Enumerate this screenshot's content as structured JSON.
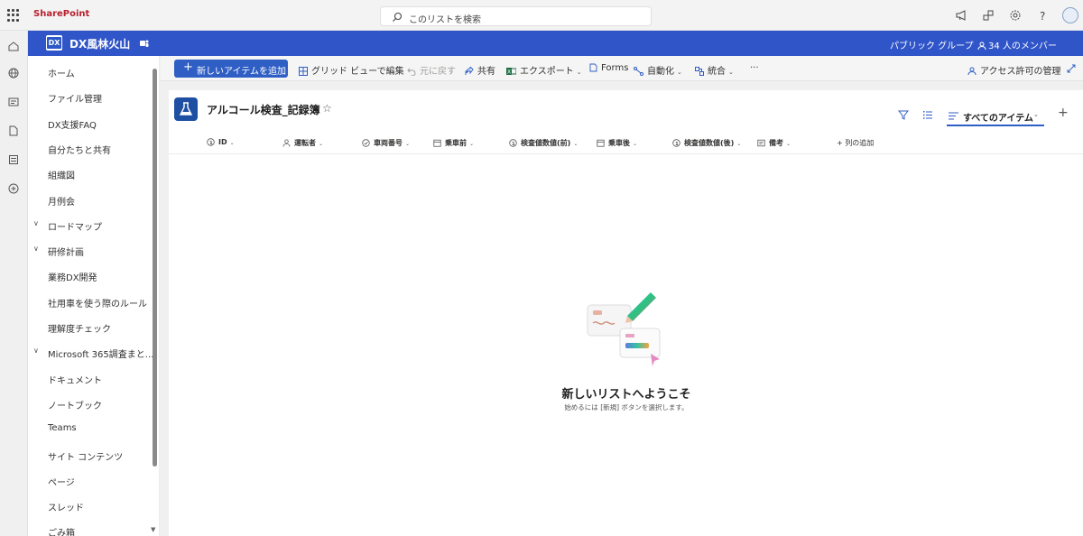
{
  "suite": {
    "brand": "SharePoint",
    "search_placeholder": "このリストを検索"
  },
  "site": {
    "logo_text": "DX",
    "name": "DX風林火山",
    "group_type": "パブリック グループ",
    "members": "34 人のメンバー"
  },
  "nav": {
    "items": [
      {
        "label": "ホーム"
      },
      {
        "label": "ファイル管理"
      },
      {
        "label": "DX支援FAQ"
      },
      {
        "label": "自分たちと共有"
      },
      {
        "label": "組織図"
      },
      {
        "label": "月例会"
      },
      {
        "label": "ロードマップ",
        "expandable": true
      },
      {
        "label": "研修計画",
        "expandable": true
      },
      {
        "label": "業務DX開発"
      },
      {
        "label": "社用車を使う際のルール"
      },
      {
        "label": "理解度チェック"
      },
      {
        "label": "Microsoft 365調査まと...",
        "expandable": true
      },
      {
        "label": "ドキュメント"
      },
      {
        "label": "ノートブック"
      },
      {
        "label": "Teams"
      },
      {
        "label": "サイト コンテンツ"
      },
      {
        "label": "ページ"
      },
      {
        "label": "スレッド"
      },
      {
        "label": "ごみ箱"
      }
    ]
  },
  "commands": {
    "new_item": "新しいアイテムを追加",
    "grid_edit": "グリッド ビューで編集",
    "undo": "元に戻す",
    "share": "共有",
    "export": "エクスポート",
    "forms": "Forms",
    "automate": "自動化",
    "integrate": "統合",
    "more": "···",
    "access": "アクセス許可の管理"
  },
  "list": {
    "title": "アルコール検査_記録簿",
    "view_name": "すべてのアイテム",
    "columns": [
      {
        "label": "ID",
        "icon": "number-icon"
      },
      {
        "label": "運転者",
        "icon": "person-icon"
      },
      {
        "label": "車両番号",
        "icon": "choice-icon"
      },
      {
        "label": "乗車前",
        "icon": "calendar-icon"
      },
      {
        "label": "検査値数値(前)",
        "icon": "number-icon"
      },
      {
        "label": "乗車後",
        "icon": "calendar-icon"
      },
      {
        "label": "検査値数値(後)",
        "icon": "number-icon"
      },
      {
        "label": "備考",
        "icon": "text-icon"
      }
    ],
    "add_column": "列の追加"
  },
  "empty_state": {
    "title": "新しいリストへようこそ",
    "subtitle": "始めるには [新規] ボタンを選択します。"
  },
  "colors": {
    "accent": "#3055c8",
    "brand_red": "#b7202e",
    "primary_button": "#2f5ec4"
  }
}
